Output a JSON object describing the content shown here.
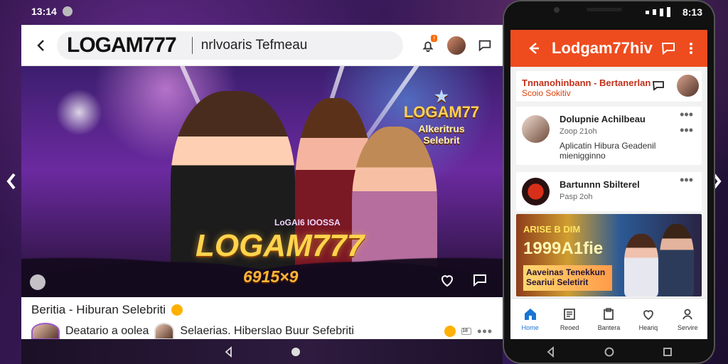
{
  "status": {
    "left_time": "13:14",
    "phone_time": "8:13"
  },
  "main_app": {
    "brand": "LOGAM777",
    "search_text": "nrlvoaris Tefmeau",
    "notification_count": "!",
    "section_title": "Beritia - Hiburan Selebriti",
    "feed_left_text": "Deatario a oolea",
    "feed_mid_text": "Selaerias. Hiberslao Buur Sefebriti",
    "feed_tag": "18",
    "hero_logo_small_top": "LOGAM77",
    "hero_logo_small_bottom": "Alkeritrus Selebrit",
    "hero_logo_big": "LOGAM777",
    "hero_number": "6915×9",
    "hero_small_text": "LoGAI6 IOOSSA"
  },
  "phone": {
    "header_title": "Lodgam77hiv",
    "card1_line1": "Tnnanohinbann - Bertanerlan",
    "card1_line2": "Scoio Sokitiv",
    "card2_name": "Dolupnie Achilbeau",
    "card2_meta": "Zoop 21oh",
    "card2_desc": "Aplicatin Hibura Geadenil mienigginno",
    "card3_name": "Bartunnn Sbilterel",
    "card3_meta": "Pasp 2oh",
    "banner_line1": "ARISE B DIM",
    "banner_line2": "1999A1fie",
    "banner_line3": "Aaveinas Tenekkun Seariui Seletirit",
    "tabs": [
      {
        "label": "Home",
        "icon": "home-icon"
      },
      {
        "label": "Reoed",
        "icon": "newspaper-icon"
      },
      {
        "label": "Bantera",
        "icon": "clipboard-icon"
      },
      {
        "label": "Heariq",
        "icon": "heart-icon"
      },
      {
        "label": "Servire",
        "icon": "profile-icon"
      }
    ]
  }
}
